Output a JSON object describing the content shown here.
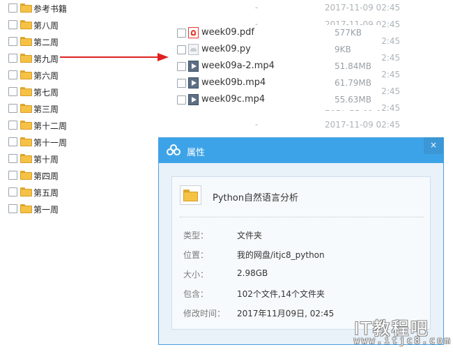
{
  "folders": [
    {
      "name": "参考书籍",
      "size": "-",
      "date": "2017-11-09 02:45"
    },
    {
      "name": "第八周",
      "size": "-",
      "date": "2017-11-09 02:45"
    },
    {
      "name": "第二周",
      "size": "-",
      "date": "2017-11-09 02:45"
    },
    {
      "name": "第九周",
      "size": "-",
      "date": "2017-11-09 02:45"
    },
    {
      "name": "第六周",
      "size": "-",
      "date": "2017-11-09 02:45"
    },
    {
      "name": "第七周",
      "size": "-",
      "date": "2017-11-09 02:45"
    },
    {
      "name": "第三周",
      "size": "-",
      "date": "2017-11-09 02:45"
    },
    {
      "name": "第十二周",
      "size": "-",
      "date": "2017-11-09 02:45"
    },
    {
      "name": "第十一周",
      "size": "",
      "date": ""
    },
    {
      "name": "第十周",
      "size": "",
      "date": ""
    },
    {
      "name": "第四周",
      "size": "",
      "date": ""
    },
    {
      "name": "第五周",
      "size": "",
      "date": ""
    },
    {
      "name": "第一周",
      "size": "",
      "date": ""
    }
  ],
  "files": [
    {
      "name": "week09.pdf",
      "size": "577KB",
      "icon": "pdf-icon"
    },
    {
      "name": "week09.py",
      "size": "9KB",
      "icon": "python-file-icon"
    },
    {
      "name": "week09a-2.mp4",
      "size": "51.84MB",
      "icon": "video-icon"
    },
    {
      "name": "week09b.mp4",
      "size": "61.79MB",
      "icon": "video-icon"
    },
    {
      "name": "week09c.mp4",
      "size": "55.63MB",
      "icon": "video-icon"
    }
  ],
  "dialog": {
    "title": "属性",
    "close": "×",
    "folder_name": "Python自然语言分析",
    "props": [
      {
        "label": "类型：",
        "value": "文件夹"
      },
      {
        "label": "位置：",
        "value": "我的网盘/itjc8_python"
      },
      {
        "label": "大小：",
        "value": "2.98GB"
      },
      {
        "label": "包含：",
        "value": "102个文件,14个文件夹"
      },
      {
        "label": "修改时间：",
        "value": "2017年11月09日, 02:45"
      }
    ]
  },
  "watermark": {
    "main": "IT教程吧",
    "sub": "www.itjc8.com"
  },
  "colors": {
    "accent": "#3da3e8",
    "arrow": "#e02020",
    "folder": "#f5c245"
  }
}
